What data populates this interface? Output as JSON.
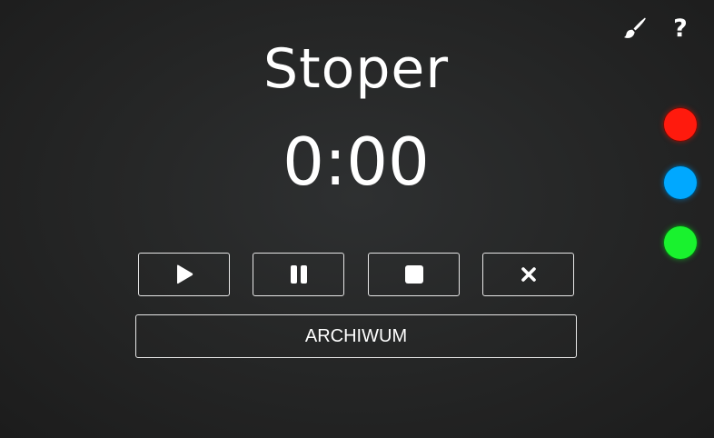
{
  "header": {
    "title": "Stoper",
    "icons": [
      "paint-brush-icon",
      "question-mark-icon"
    ],
    "help_glyph": "?"
  },
  "timer": {
    "display": "0:00"
  },
  "controls": [
    {
      "name": "start",
      "icon": "play-icon"
    },
    {
      "name": "pause",
      "icon": "pause-icon"
    },
    {
      "name": "stop",
      "icon": "stop-icon"
    },
    {
      "name": "reset",
      "icon": "close-icon"
    }
  ],
  "archive": {
    "label": "ARCHIWUM"
  },
  "themes": {
    "colors": [
      "#ff1a0d",
      "#00a8ff",
      "#19f22e"
    ]
  }
}
